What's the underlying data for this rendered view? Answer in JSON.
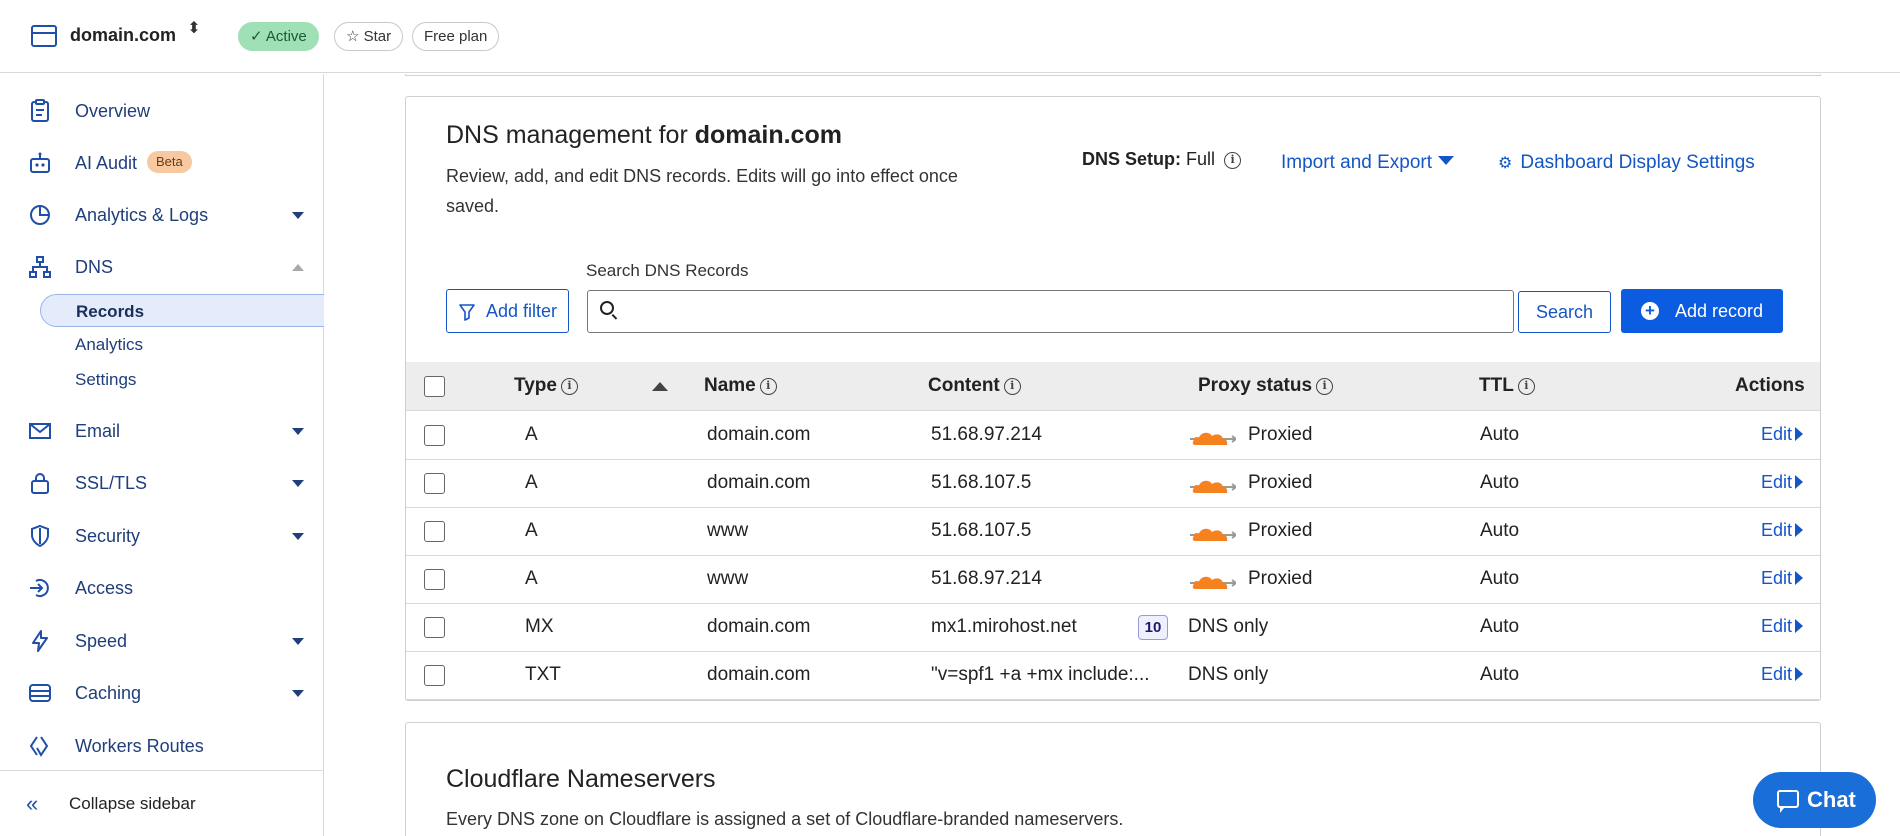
{
  "topbar": {
    "zone_name": "domain.com",
    "zone_switch_icon": "⬍",
    "status": "Active",
    "star": "Star",
    "plan": "Free plan"
  },
  "sidebar": {
    "items": [
      {
        "label": "Overview",
        "icon": "clipboard-icon"
      },
      {
        "label": "AI Audit",
        "icon": "robot-icon",
        "badge": "Beta"
      },
      {
        "label": "Analytics & Logs",
        "icon": "pie-chart-icon"
      },
      {
        "label": "DNS",
        "icon": "network-icon"
      },
      {
        "label": "Email",
        "icon": "envelope-icon"
      },
      {
        "label": "SSL/TLS",
        "icon": "lock-icon"
      },
      {
        "label": "Security",
        "icon": "shield-icon"
      },
      {
        "label": "Access",
        "icon": "access-icon"
      },
      {
        "label": "Speed",
        "icon": "lightning-icon"
      },
      {
        "label": "Caching",
        "icon": "storage-icon"
      },
      {
        "label": "Workers Routes",
        "icon": "workers-icon"
      }
    ],
    "dns_sub": [
      "Records",
      "Analytics",
      "Settings"
    ],
    "collapse_label": "Collapse sidebar"
  },
  "dns": {
    "title_prefix": "DNS management for ",
    "title_domain": "domain.com",
    "description": "Review, add, and edit DNS records. Edits will go into effect once saved.",
    "setup_label": "DNS Setup:",
    "setup_value": "Full",
    "import_export": "Import and Export",
    "display_settings": "Dashboard Display Settings",
    "search_label": "Search DNS Records",
    "search_value": "",
    "add_filter": "Add filter",
    "search_button": "Search",
    "add_record": "Add record"
  },
  "table": {
    "columns": {
      "type": "Type",
      "name": "Name",
      "content": "Content",
      "proxy": "Proxy status",
      "ttl": "TTL",
      "actions": "Actions"
    },
    "rows": [
      {
        "type": "A",
        "name": "domain.com",
        "content": "51.68.97.214",
        "proxy": "Proxied",
        "ttl": "Auto",
        "action": "Edit"
      },
      {
        "type": "A",
        "name": "domain.com",
        "content": "51.68.107.5",
        "proxy": "Proxied",
        "ttl": "Auto",
        "action": "Edit"
      },
      {
        "type": "A",
        "name": "www",
        "content": "51.68.107.5",
        "proxy": "Proxied",
        "ttl": "Auto",
        "action": "Edit"
      },
      {
        "type": "A",
        "name": "www",
        "content": "51.68.97.214",
        "proxy": "Proxied",
        "ttl": "Auto",
        "action": "Edit"
      },
      {
        "type": "MX",
        "name": "domain.com",
        "content": "mx1.mirohost.net",
        "priority": "10",
        "proxy": "DNS only",
        "ttl": "Auto",
        "action": "Edit"
      },
      {
        "type": "TXT",
        "name": "domain.com",
        "content": "\"v=spf1 +a +mx include:...",
        "proxy": "DNS only",
        "ttl": "Auto",
        "action": "Edit"
      }
    ]
  },
  "nameservers": {
    "title": "Cloudflare Nameservers",
    "description": "Every DNS zone on Cloudflare is assigned a set of Cloudflare-branded nameservers."
  },
  "chat": {
    "label": "Chat"
  },
  "colors": {
    "accent": "#1456c6",
    "primary_button": "#0b5ce0",
    "active_badge": "#9fe0b7",
    "proxied_cloud": "#f6821f",
    "sidebar_text": "#1f3e7a"
  }
}
